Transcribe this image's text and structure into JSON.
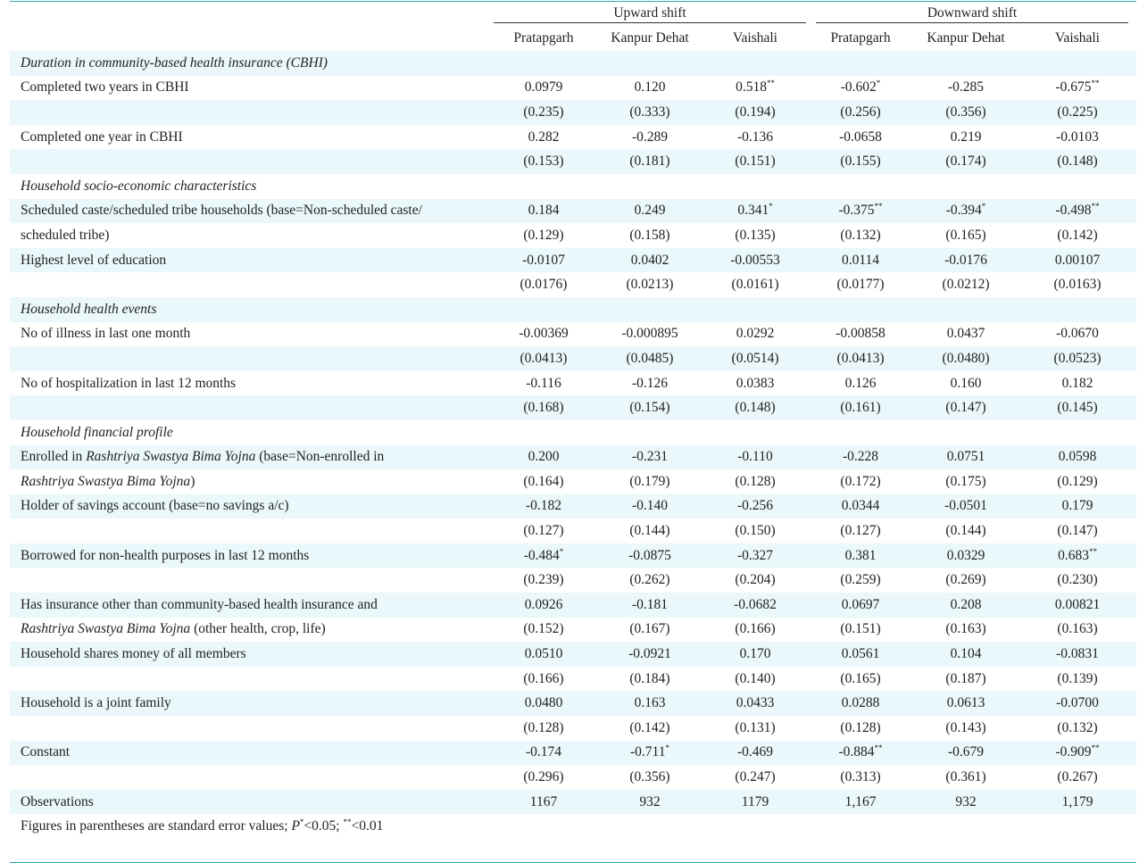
{
  "header": {
    "group_up": "Upward shift",
    "group_down": "Downward shift",
    "cols": [
      "Pratapgarh",
      "Kanpur Dehat",
      "Vaishali",
      "Pratapgarh",
      "Kanpur Dehat",
      "Vaishali"
    ]
  },
  "sections": [
    {
      "title": "Duration in community-based health insurance (CBHI)",
      "rows": [
        {
          "label": "Completed two years in CBHI",
          "label2": "",
          "coef": [
            "0.0979",
            "0.120",
            "0.518",
            "-0.602",
            "-0.285",
            "-0.675"
          ],
          "sig": [
            "",
            "",
            "**",
            "*",
            "",
            "**"
          ],
          "se": [
            "(0.235)",
            "(0.333)",
            "(0.194)",
            "(0.256)",
            "(0.356)",
            "(0.225)"
          ]
        },
        {
          "label": "Completed one year in CBHI",
          "label2": "",
          "coef": [
            "0.282",
            "-0.289",
            "-0.136",
            "-0.0658",
            "0.219",
            "-0.0103"
          ],
          "sig": [
            "",
            "",
            "",
            "",
            "",
            ""
          ],
          "se": [
            "(0.153)",
            "(0.181)",
            "(0.151)",
            "(0.155)",
            "(0.174)",
            "(0.148)"
          ]
        }
      ]
    },
    {
      "title": "Household socio-economic characteristics",
      "rows": [
        {
          "label": "Scheduled caste/scheduled tribe households (base=Non-scheduled caste/",
          "label2": "scheduled tribe)",
          "coef": [
            "0.184",
            "0.249",
            "0.341",
            "-0.375",
            "-0.394",
            "-0.498"
          ],
          "sig": [
            "",
            "",
            "*",
            "**",
            "*",
            "**"
          ],
          "se": [
            "(0.129)",
            "(0.158)",
            "(0.135)",
            "(0.132)",
            "(0.165)",
            "(0.142)"
          ]
        },
        {
          "label": "Highest level of education",
          "label2": "",
          "coef": [
            "-0.0107",
            "0.0402",
            "-0.00553",
            "0.0114",
            "-0.0176",
            "0.00107"
          ],
          "sig": [
            "",
            "",
            "",
            "",
            "",
            ""
          ],
          "se": [
            "(0.0176)",
            "(0.0213)",
            "(0.0161)",
            "(0.0177)",
            "(0.0212)",
            "(0.0163)"
          ]
        }
      ]
    },
    {
      "title": "Household health events",
      "rows": [
        {
          "label": "No of illness in last one month",
          "label2": "",
          "coef": [
            "-0.00369",
            "-0.000895",
            "0.0292",
            "-0.00858",
            "0.0437",
            "-0.0670"
          ],
          "sig": [
            "",
            "",
            "",
            "",
            "",
            ""
          ],
          "se": [
            "(0.0413)",
            "(0.0485)",
            "(0.0514)",
            "(0.0413)",
            "(0.0480)",
            "(0.0523)"
          ]
        },
        {
          "label": "No of hospitalization in last 12 months",
          "label2": "",
          "coef": [
            "-0.116",
            "-0.126",
            "0.0383",
            "0.126",
            "0.160",
            "0.182"
          ],
          "sig": [
            "",
            "",
            "",
            "",
            "",
            ""
          ],
          "se": [
            "(0.168)",
            "(0.154)",
            "(0.148)",
            "(0.161)",
            "(0.147)",
            "(0.145)"
          ]
        }
      ]
    },
    {
      "title": "Household financial profile",
      "rows": [
        {
          "label_pre": "Enrolled in ",
          "label_it": "Rashtriya Swastya Bima Yojna",
          "label_post": " (base=Non-enrolled in",
          "label2_it": "Rashtriya Swastya Bima Yojna",
          "label2_post": ")",
          "coef": [
            "0.200",
            "-0.231",
            "-0.110",
            "-0.228",
            "0.0751",
            "0.0598"
          ],
          "sig": [
            "",
            "",
            "",
            "",
            "",
            ""
          ],
          "se": [
            "(0.164)",
            "(0.179)",
            "(0.128)",
            "(0.172)",
            "(0.175)",
            "(0.129)"
          ]
        },
        {
          "label": "Holder of savings account (base=no savings a/c)",
          "label2": "",
          "coef": [
            "-0.182",
            "-0.140",
            "-0.256",
            "0.0344",
            "-0.0501",
            "0.179"
          ],
          "sig": [
            "",
            "",
            "",
            "",
            "",
            ""
          ],
          "se": [
            "(0.127)",
            "(0.144)",
            "(0.150)",
            "(0.127)",
            "(0.144)",
            "(0.147)"
          ]
        },
        {
          "label": "Borrowed for non-health purposes in last 12 months",
          "label2": "",
          "coef": [
            "-0.484",
            "-0.0875",
            "-0.327",
            "0.381",
            "0.0329",
            "0.683"
          ],
          "sig": [
            "*",
            "",
            "",
            "",
            "",
            "**"
          ],
          "se": [
            "(0.239)",
            "(0.262)",
            "(0.204)",
            "(0.259)",
            "(0.269)",
            "(0.230)"
          ]
        },
        {
          "label": "Has insurance other than community-based health insurance and",
          "label2_it": "Rashtriya Swastya Bima Yojna",
          "label2_post": " (other health, crop, life)",
          "coef": [
            "0.0926",
            "-0.181",
            "-0.0682",
            "0.0697",
            "0.208",
            "0.00821"
          ],
          "sig": [
            "",
            "",
            "",
            "",
            "",
            ""
          ],
          "se": [
            "(0.152)",
            "(0.167)",
            "(0.166)",
            "(0.151)",
            "(0.163)",
            "(0.163)"
          ]
        },
        {
          "label": "Household shares money of all members",
          "label2": "",
          "coef": [
            "0.0510",
            "-0.0921",
            "0.170",
            "0.0561",
            "0.104",
            "-0.0831"
          ],
          "sig": [
            "",
            "",
            "",
            "",
            "",
            ""
          ],
          "se": [
            "(0.166)",
            "(0.184)",
            "(0.140)",
            "(0.165)",
            "(0.187)",
            "(0.139)"
          ]
        },
        {
          "label": "Household is a joint family",
          "label2": "",
          "coef": [
            "0.0480",
            "0.163",
            "0.0433",
            "0.0288",
            "0.0613",
            "-0.0700"
          ],
          "sig": [
            "",
            "",
            "",
            "",
            "",
            ""
          ],
          "se": [
            "(0.128)",
            "(0.142)",
            "(0.131)",
            "(0.128)",
            "(0.143)",
            "(0.132)"
          ]
        },
        {
          "label": "Constant",
          "label2": "",
          "coef": [
            "-0.174",
            "-0.711",
            "-0.469",
            "-0.884",
            "-0.679",
            "-0.909"
          ],
          "sig": [
            "",
            "*",
            "",
            "**",
            "",
            "**"
          ],
          "se": [
            "(0.296)",
            "(0.356)",
            "(0.247)",
            "(0.313)",
            "(0.361)",
            "(0.267)"
          ]
        }
      ]
    }
  ],
  "observations": {
    "label": "Observations",
    "values": [
      "1167",
      "932",
      "1179",
      "1,167",
      "932",
      "1,179"
    ]
  },
  "footnote": {
    "pre": "Figures in parentheses are standard error values; ",
    "p": "P",
    "s1": "*",
    "mid": "<0.05; ",
    "s2": "**",
    "post": "<0.01"
  }
}
